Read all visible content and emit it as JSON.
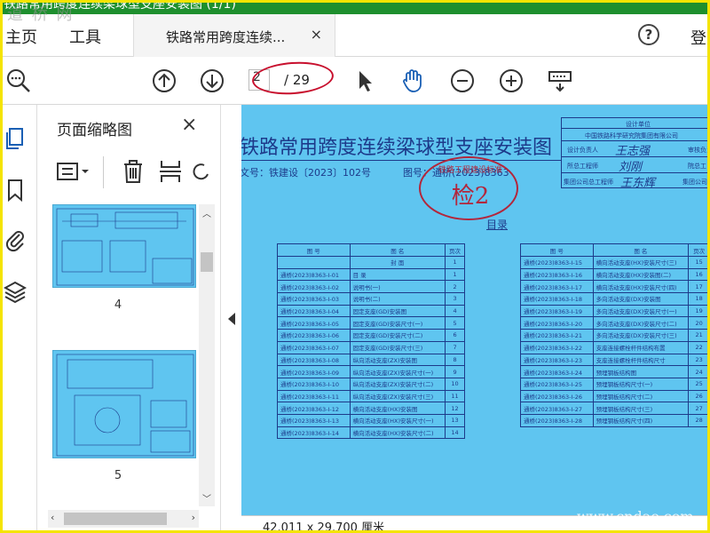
{
  "titlebar": {
    "text": "铁路常用跨度连续梁球型支座安装图 (1/1)"
  },
  "watermark": {
    "top": "道 桥 网",
    "bottom": "www.cndao.com"
  },
  "menu": {
    "home": "主页",
    "tools": "工具",
    "login": "登"
  },
  "tab": {
    "title": "铁路常用跨度连续...",
    "close": "×"
  },
  "help": "?",
  "toolbar": {
    "page_current": "2",
    "page_total": "/ 29"
  },
  "thumbnails": {
    "title": "页面缩略图",
    "close": "×",
    "items": [
      {
        "label": "4"
      },
      {
        "label": "5"
      }
    ]
  },
  "document": {
    "title": "铁路常用跨度连续梁球型支座安装图",
    "doc_no": "文号：铁建设〔2023〕102号",
    "fig_no": "图号：通桥(2023)8363",
    "stamp_text": "检2",
    "stamp_arc": "铁路工程建设标准",
    "mulu": "目录",
    "sig": {
      "unit_label": "设计单位",
      "unit": "中国铁路科学研究院集团有限公司",
      "design_lead": "设计负责人",
      "chief_engineer": "所总工程师",
      "group_chief": "集团公司总工程师",
      "reviewer": "审核负责",
      "institute_chief": "院总工",
      "group_chief_2": "集团公司"
    },
    "signatures": [
      "王志强",
      "刘刚",
      "王东辉"
    ],
    "table_headers": [
      "图 号",
      "图 名",
      "页次"
    ],
    "left_rows": [
      [
        "",
        "封 面",
        "1"
      ],
      [
        "通桥(2023)8363-Ⅰ-01",
        "目 录",
        "1"
      ],
      [
        "通桥(2023)8363-Ⅰ-02",
        "说明书(一)",
        "2"
      ],
      [
        "通桥(2023)8363-Ⅰ-03",
        "说明书(二)",
        "3"
      ],
      [
        "通桥(2023)8363-Ⅰ-04",
        "固定支座(GD)安装图",
        "4"
      ],
      [
        "通桥(2023)8363-Ⅰ-05",
        "固定支座(GD)安装尺寸(一)",
        "5"
      ],
      [
        "通桥(2023)8363-Ⅰ-06",
        "固定支座(GD)安装尺寸(二)",
        "6"
      ],
      [
        "通桥(2023)8363-Ⅰ-07",
        "固定支座(GD)安装尺寸(三)",
        "7"
      ],
      [
        "通桥(2023)8363-Ⅰ-08",
        "纵向活动支座(ZX)安装图",
        "8"
      ],
      [
        "通桥(2023)8363-Ⅰ-09",
        "纵向活动支座(ZX)安装尺寸(一)",
        "9"
      ],
      [
        "通桥(2023)8363-Ⅰ-10",
        "纵向活动支座(ZX)安装尺寸(二)",
        "10"
      ],
      [
        "通桥(2023)8363-Ⅰ-11",
        "纵向活动支座(ZX)安装尺寸(三)",
        "11"
      ],
      [
        "通桥(2023)8363-Ⅰ-12",
        "横向活动支座(HX)安装图",
        "12"
      ],
      [
        "通桥(2023)8363-Ⅰ-13",
        "横向活动支座(HX)安装尺寸(一)",
        "13"
      ],
      [
        "通桥(2023)8363-Ⅰ-14",
        "横向活动支座(HX)安装尺寸(二)",
        "14"
      ]
    ],
    "right_rows": [
      [
        "通桥(2023)8363-Ⅰ-15",
        "横向活动支座(HX)安装尺寸(三)",
        "15"
      ],
      [
        "通桥(2023)8363-Ⅰ-16",
        "横向活动支座(HX)安装图(二)",
        "16"
      ],
      [
        "通桥(2023)8363-Ⅰ-17",
        "横向活动支座(HX)安装尺寸(四)",
        "17"
      ],
      [
        "通桥(2023)8363-Ⅰ-18",
        "多向活动支座(DX)安装图",
        "18"
      ],
      [
        "通桥(2023)8363-Ⅰ-19",
        "多向活动支座(DX)安装尺寸(一)",
        "19"
      ],
      [
        "通桥(2023)8363-Ⅰ-20",
        "多向活动支座(DX)安装尺寸(二)",
        "20"
      ],
      [
        "通桥(2023)8363-Ⅰ-21",
        "多向活动支座(DX)安装尺寸(三)",
        "21"
      ],
      [
        "通桥(2023)8363-Ⅰ-22",
        "支座连接螺栓杆件结构布置",
        "22"
      ],
      [
        "通桥(2023)8363-Ⅰ-23",
        "支座连接螺栓杆件结构尺寸",
        "23"
      ],
      [
        "通桥(2023)8363-Ⅰ-24",
        "预埋钢板结构图",
        "24"
      ],
      [
        "通桥(2023)8363-Ⅰ-25",
        "预埋钢板结构尺寸(一)",
        "25"
      ],
      [
        "通桥(2023)8363-Ⅰ-26",
        "预埋钢板结构尺寸(二)",
        "26"
      ],
      [
        "通桥(2023)8363-Ⅰ-27",
        "预埋钢板结构尺寸(三)",
        "27"
      ],
      [
        "通桥(2023)8363-Ⅰ-28",
        "预埋钢板结构尺寸(四)",
        "28"
      ]
    ]
  },
  "status": {
    "page_size": "42.011 x 29.700 厘米"
  },
  "colors": {
    "page_bg": "#5fc5f0",
    "ink": "#1d3a8a",
    "stamp": "#b3263b",
    "frame": "#f5e400",
    "titlebar": "#1e8f2e"
  }
}
